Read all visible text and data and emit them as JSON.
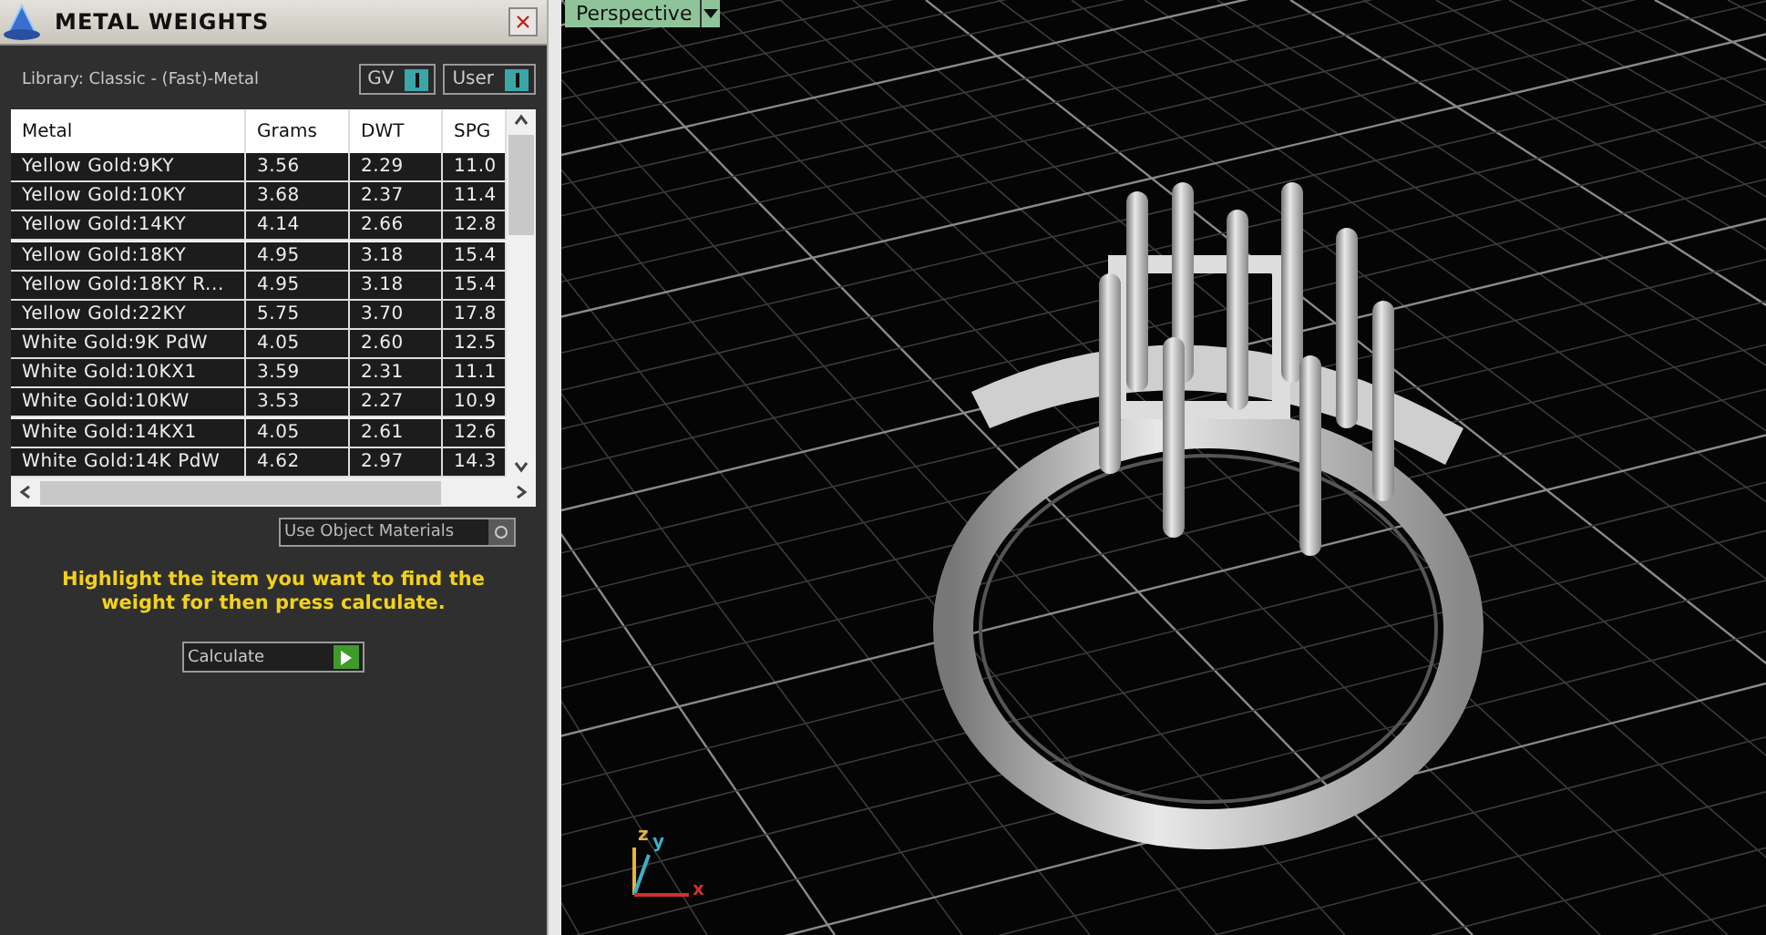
{
  "panel": {
    "title": "METAL WEIGHTS",
    "library": "Library: Classic - (Fast)-Metal",
    "toggles": [
      {
        "label": "GV",
        "on": true
      },
      {
        "label": "User",
        "on": true
      }
    ],
    "table": {
      "columns": [
        "Metal",
        "Grams",
        "DWT",
        "SPG"
      ],
      "rows": [
        {
          "cells": [
            "Yellow Gold:9KY",
            "3.56",
            "2.29",
            "11.0"
          ],
          "selected": false
        },
        {
          "cells": [
            "Yellow Gold:10KY",
            "3.68",
            "2.37",
            "11.4"
          ],
          "selected": false
        },
        {
          "cells": [
            "Yellow Gold:14KY",
            "4.14",
            "2.66",
            "12.8"
          ],
          "selected": false
        },
        {
          "cells": [
            "Yellow Gold:18KY",
            "4.95",
            "3.18",
            "15.4"
          ],
          "selected": false
        },
        {
          "cells": [
            "Yellow Gold:18KY R...",
            "4.95",
            "3.18",
            "15.4"
          ],
          "selected": false
        },
        {
          "cells": [
            "Yellow Gold:22KY",
            "5.75",
            "3.70",
            "17.8"
          ],
          "selected": false
        },
        {
          "cells": [
            "White Gold:9K PdW",
            "4.05",
            "2.60",
            "12.5"
          ],
          "selected": false
        },
        {
          "cells": [
            "White Gold:10KX1",
            "3.59",
            "2.31",
            "11.1"
          ],
          "selected": false
        },
        {
          "cells": [
            "White Gold:10KW",
            "3.53",
            "2.27",
            "10.9"
          ],
          "selected": false
        },
        {
          "cells": [
            "White Gold:14KX1",
            "4.05",
            "2.61",
            "12.6"
          ],
          "selected": false
        },
        {
          "cells": [
            "White Gold:14K PdW",
            "4.62",
            "2.97",
            "14.3"
          ],
          "selected": false
        }
      ]
    },
    "object_materials": {
      "label": "Use Object Materials",
      "on": false
    },
    "hint": "Highlight the item you want to find the weight for then press calculate.",
    "calculate": "Calculate"
  },
  "viewport": {
    "label": "Perspective",
    "axes": [
      "z",
      "y",
      "x"
    ]
  }
}
